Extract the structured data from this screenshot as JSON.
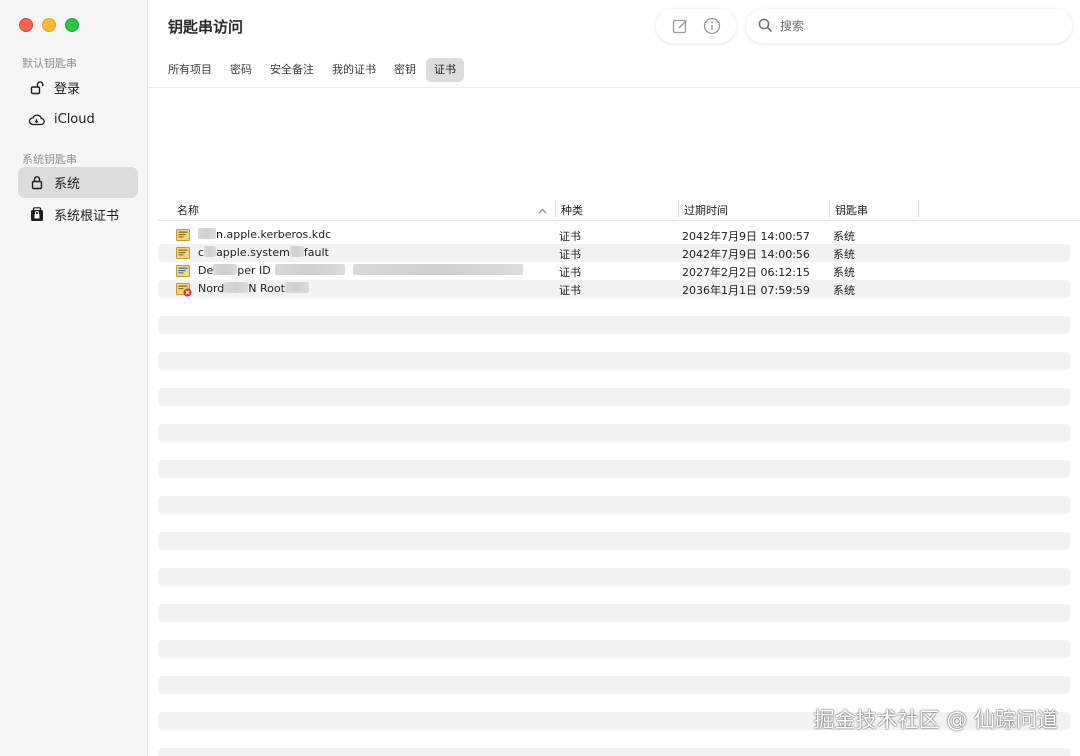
{
  "window": {
    "title": "钥匙串访问"
  },
  "sidebar": {
    "default_section": "默认钥匙串",
    "default_items": [
      {
        "label": "登录",
        "icon": "unlocked-padlock-icon"
      },
      {
        "label": "iCloud",
        "icon": "cloud-icon"
      }
    ],
    "system_section": "系统钥匙串",
    "system_items": [
      {
        "label": "系统",
        "icon": "padlock-icon",
        "selected": true
      },
      {
        "label": "系统根证书",
        "icon": "cabinet-lock-icon"
      }
    ]
  },
  "toolbar": {
    "search_placeholder": "搜索",
    "icons": [
      "compose-icon",
      "info-icon"
    ]
  },
  "tabs": [
    {
      "label": "所有项目"
    },
    {
      "label": "密码"
    },
    {
      "label": "安全备注"
    },
    {
      "label": "我的证书"
    },
    {
      "label": "密钥"
    },
    {
      "label": "证书",
      "active": true
    }
  ],
  "table": {
    "columns": [
      "名称",
      "种类",
      "过期时间",
      "钥匙串"
    ],
    "sorted_column": "名称",
    "rows": [
      {
        "name_prefix": "",
        "name_suffix": "n.apple.kerberos.kdc",
        "kind": "证书",
        "expires": "2042年7月9日 14:00:57",
        "keychain": "系统",
        "icon": "certificate-icon"
      },
      {
        "name_prefix": "c",
        "name_suffix": "apple.system",
        "name_tail": "fault",
        "kind": "证书",
        "expires": "2042年7月9日 14:00:56",
        "keychain": "系统",
        "icon": "certificate-icon"
      },
      {
        "name_prefix": "De",
        "name_suffix": "per ID",
        "kind": "证书",
        "expires": "2027年2月2日 06:12:15",
        "keychain": "系统",
        "icon": "certificate-blue-icon"
      },
      {
        "name_prefix": "Nord",
        "name_suffix": "N Root",
        "kind": "证书",
        "expires": "2036年1月1日 07:59:59",
        "keychain": "系统",
        "icon": "certificate-invalid-icon"
      }
    ]
  },
  "watermark": "掘金技术社区 @ 仙踪问道",
  "colors": {
    "close": "#fe5f57",
    "minimize": "#febc2e",
    "zoom": "#28c840",
    "selected_bg": "#dcdcdc",
    "stripe": "#f2f2f2"
  }
}
